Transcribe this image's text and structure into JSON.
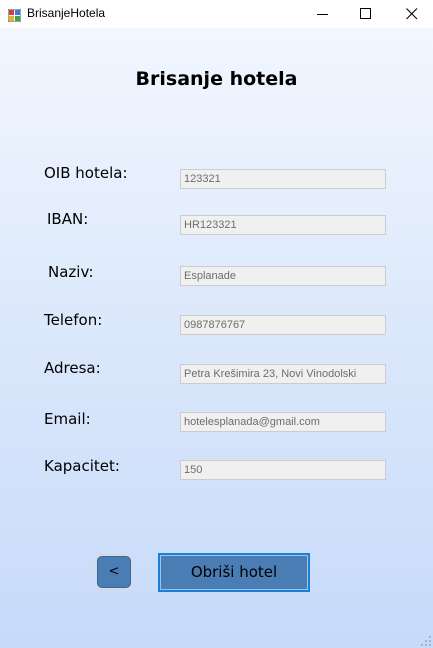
{
  "window": {
    "title": "BrisanjeHotela",
    "icon": "winforms-app-icon",
    "controls": [
      "minimize-icon",
      "maximize-icon",
      "close-icon"
    ]
  },
  "heading": "Brisanje hotela",
  "fields": {
    "oib": {
      "label": "OIB hotela:",
      "value": "123321"
    },
    "iban": {
      "label": "IBAN:",
      "value": "HR123321"
    },
    "naziv": {
      "label": "Naziv:",
      "value": "Esplanade"
    },
    "telefon": {
      "label": "Telefon:",
      "value": "0987876767"
    },
    "adresa": {
      "label": "Adresa:",
      "value": "Petra Krešimira 23, Novi Vinodolski"
    },
    "email": {
      "label": "Email:",
      "value": "hotelesplanada@gmail.com"
    },
    "kapacitet": {
      "label": "Kapacitet:",
      "value": "150"
    }
  },
  "buttons": {
    "back_label": "<",
    "delete_label": "Obriši hotel"
  },
  "colors": {
    "button_fill": "#4a7db3",
    "button_focus_border": "#1a7fd6",
    "input_bg": "#f0f0f0",
    "input_text": "#6d6d6d"
  }
}
